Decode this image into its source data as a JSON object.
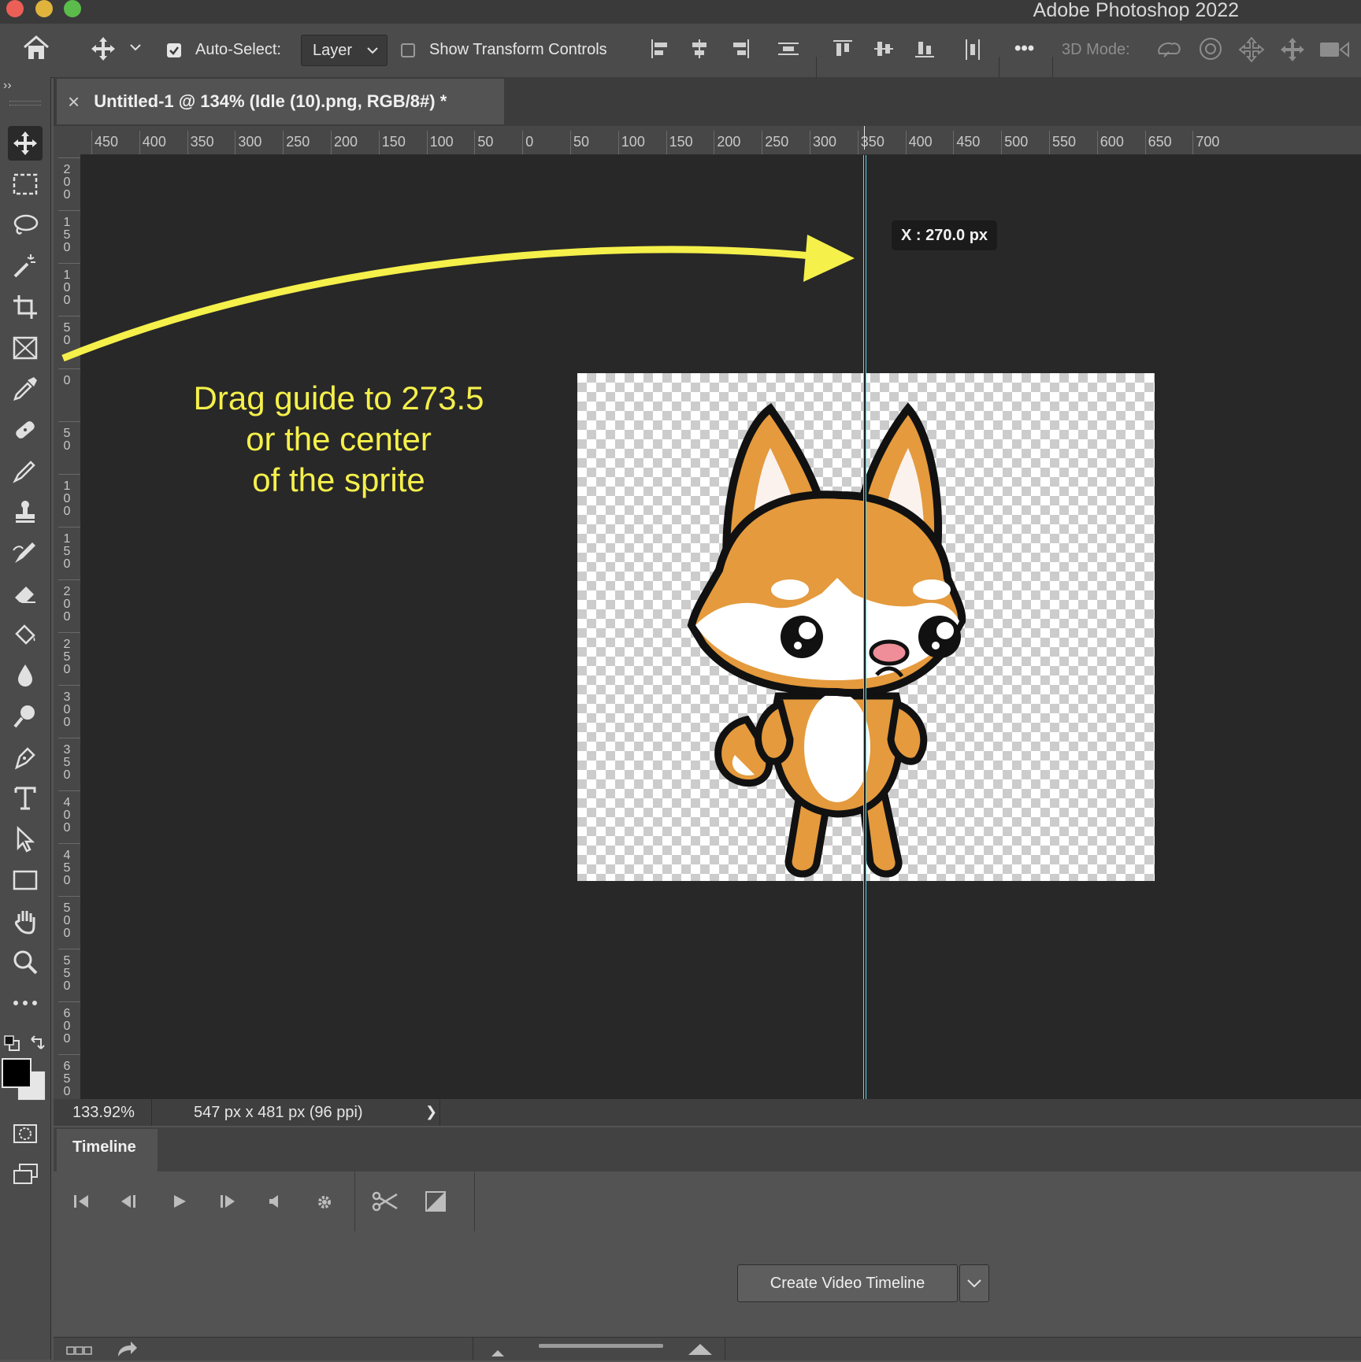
{
  "app": {
    "title": "Adobe Photoshop 2022"
  },
  "options_bar": {
    "auto_select_label": "Auto-Select:",
    "auto_select_checked": true,
    "auto_select_value": "Layer",
    "show_transform_label": "Show Transform Controls",
    "show_transform_checked": false,
    "more_label": "•••",
    "mode_3d_label": "3D Mode:"
  },
  "document": {
    "tab_title": "Untitled-1 @ 134% (Idle (10).png, RGB/8#) *",
    "close_glyph": "×"
  },
  "rulers": {
    "horizontal": [
      "450",
      "400",
      "350",
      "300",
      "250",
      "200",
      "150",
      "100",
      "50",
      "0",
      "50",
      "100",
      "150",
      "200",
      "250",
      "300",
      "350",
      "400",
      "450",
      "500",
      "550",
      "600",
      "650",
      "700"
    ],
    "vertical": [
      "200",
      "150",
      "100",
      "50",
      "0",
      "50",
      "100",
      "150",
      "200",
      "250",
      "300",
      "350",
      "400",
      "450",
      "500",
      "550",
      "600",
      "650"
    ]
  },
  "canvas": {
    "guide_tooltip": "X : 270.0 px",
    "annotation_lines": [
      "Drag guide to 273.5",
      "or the center",
      "of the sprite"
    ],
    "annotation_color": "#f5f04a",
    "guide_color": "#5cd6e8"
  },
  "status": {
    "zoom": "133.92%",
    "doc_info": "547 px x 481 px (96 ppi)",
    "arrow": "❯"
  },
  "timeline": {
    "tab_label": "Timeline",
    "create_button_label": "Create Video Timeline"
  },
  "toolbar": {
    "expand_glyph": "››",
    "tools": [
      "move-tool",
      "marquee-tool",
      "lasso-tool",
      "magic-wand-tool",
      "crop-tool",
      "frame-tool",
      "eyedropper-tool",
      "healing-brush-tool",
      "brush-tool",
      "clone-stamp-tool",
      "history-brush-tool",
      "eraser-tool",
      "paint-bucket-tool",
      "blur-tool",
      "dodge-tool",
      "pen-tool",
      "type-tool",
      "path-selection-tool",
      "rectangle-tool",
      "hand-tool",
      "zoom-tool",
      "more-tools"
    ]
  }
}
